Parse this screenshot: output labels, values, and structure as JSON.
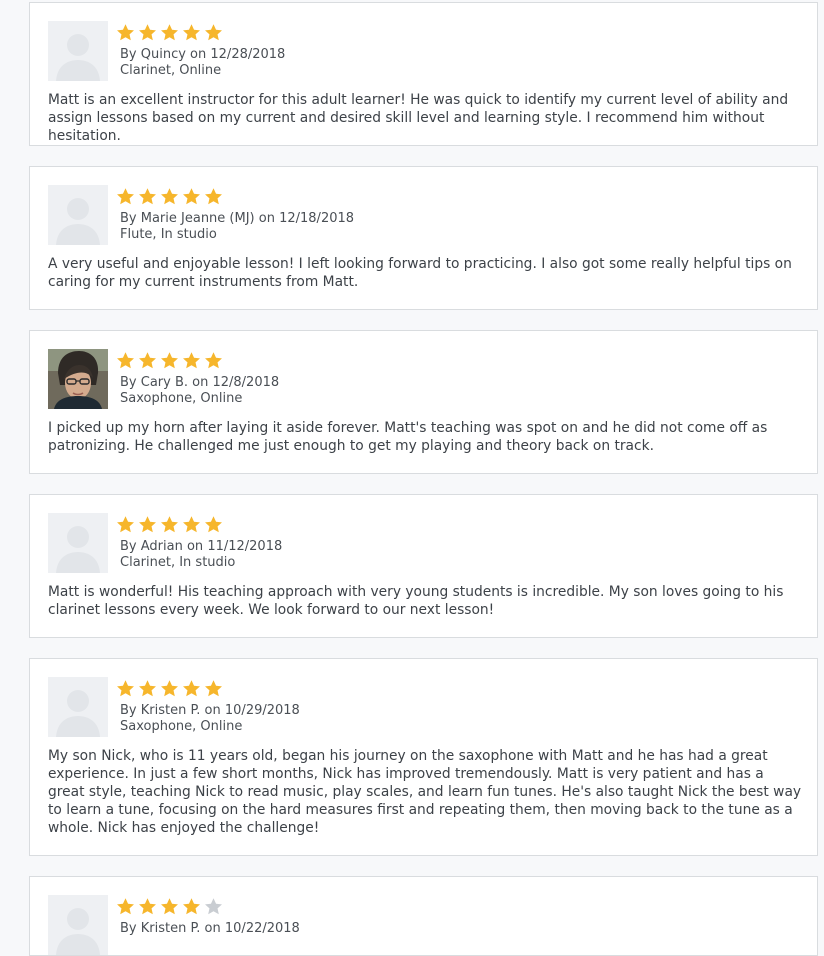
{
  "colors": {
    "star_filled": "#f6b62c",
    "star_empty": "#c9cdd2"
  },
  "reviews": [
    {
      "rating": 5,
      "author": "Quincy",
      "date": "12/28/2018",
      "details": "Clarinet, Online",
      "avatar": "placeholder",
      "text": "Matt is an excellent instructor for this adult learner! He was quick to identify my current level of ability and assign lessons based on my current and desired skill level and learning style. I recommend him without hesitation."
    },
    {
      "rating": 5,
      "author": "Marie Jeanne (MJ)",
      "date": "12/18/2018",
      "details": "Flute, In studio",
      "avatar": "placeholder",
      "text": "A very useful and enjoyable lesson! I left looking forward to practicing. I also got some really helpful tips on caring for my current instruments from Matt."
    },
    {
      "rating": 5,
      "author": "Cary B.",
      "date": "12/8/2018",
      "details": "Saxophone, Online",
      "avatar": "photo",
      "text": "I picked up my horn after laying it aside forever. Matt's teaching was spot on and he did not come off as patronizing. He challenged me just enough to get my playing and theory back on track."
    },
    {
      "rating": 5,
      "author": "Adrian",
      "date": "11/12/2018",
      "details": "Clarinet, In studio",
      "avatar": "placeholder",
      "text": "Matt is wonderful! His teaching approach with very young students is incredible. My son loves going to his clarinet lessons every week. We look forward to our next lesson!"
    },
    {
      "rating": 5,
      "author": "Kristen P.",
      "date": "10/29/2018",
      "details": "Saxophone, Online",
      "avatar": "placeholder",
      "text": "My son Nick, who is 11 years old, began his journey on the saxophone with Matt and he has had a great experience. In just a few short months, Nick has improved tremendously. Matt is very patient and has a great style, teaching Nick to read music, play scales, and learn fun tunes. He's also taught Nick the best way to learn a tune, focusing on the hard measures first and repeating them, then moving back to the tune as a whole. Nick has enjoyed the challenge!"
    },
    {
      "rating": 4,
      "author": "Kristen P.",
      "date": "10/22/2018",
      "details": "",
      "avatar": "placeholder",
      "text": ""
    }
  ]
}
